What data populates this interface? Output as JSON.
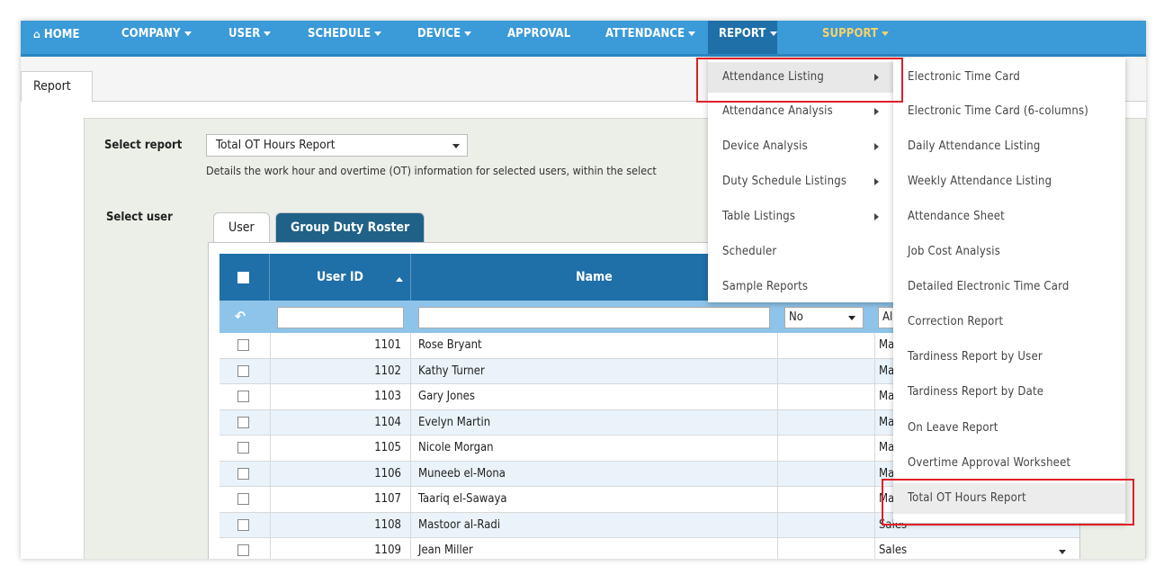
{
  "nav": {
    "home": "HOME",
    "company": "COMPANY",
    "user": "USER",
    "schedule": "SCHEDULE",
    "device": "DEVICE",
    "approval": "APPROVAL",
    "attendance": "ATTENDANCE",
    "report": "REPORT",
    "support": "SUPPORT"
  },
  "tabs": {
    "report": "Report"
  },
  "form": {
    "select_report_label": "Select report",
    "selected_report": "Total OT Hours Report",
    "description": "Details the work hour and overtime (OT) information for selected users, within the select",
    "select_user_label": "Select user"
  },
  "user_tabs": {
    "user": "User",
    "group": "Group Duty Roster"
  },
  "grid": {
    "headers": {
      "user_id": "User ID",
      "name": "Name"
    },
    "filter_select_value": "No",
    "filter_select2_value": "Al",
    "rows": [
      {
        "id": "1101",
        "name": "Rose Bryant",
        "dept": "Ma"
      },
      {
        "id": "1102",
        "name": "Kathy Turner",
        "dept": "Ma"
      },
      {
        "id": "1103",
        "name": "Gary Jones",
        "dept": "Ma"
      },
      {
        "id": "1104",
        "name": "Evelyn Martin",
        "dept": "Ma"
      },
      {
        "id": "1105",
        "name": "Nicole Morgan",
        "dept": "Ma"
      },
      {
        "id": "1106",
        "name": "Muneeb el-Mona",
        "dept": "Ma"
      },
      {
        "id": "1107",
        "name": "Taariq el-Sawaya",
        "dept": "Ma"
      },
      {
        "id": "1108",
        "name": "Mastoor al-Radi",
        "dept": "Sales"
      },
      {
        "id": "1109",
        "name": "Jean Miller",
        "dept": "Sales"
      }
    ]
  },
  "menu_report": [
    "Attendance Listing",
    "Attendance Analysis",
    "Device Analysis",
    "Duty Schedule Listings",
    "Table Listings",
    "Scheduler",
    "Sample Reports"
  ],
  "menu_attendance_listing": [
    "Electronic Time Card",
    "Electronic Time Card (6-columns)",
    "Daily Attendance Listing",
    "Weekly Attendance Listing",
    "Attendance Sheet",
    "Job Cost Analysis",
    "Detailed Electronic Time Card",
    "Correction Report",
    "Tardiness Report by User",
    "Tardiness Report by Date",
    "On Leave Report",
    "Overtime Approval Worksheet",
    "Total OT Hours Report"
  ],
  "colors": {
    "nav_bg": "#3b9ad8",
    "nav_active": "#1f6fa8",
    "support": "#f7d36b",
    "highlight_box": "#e0202a"
  }
}
